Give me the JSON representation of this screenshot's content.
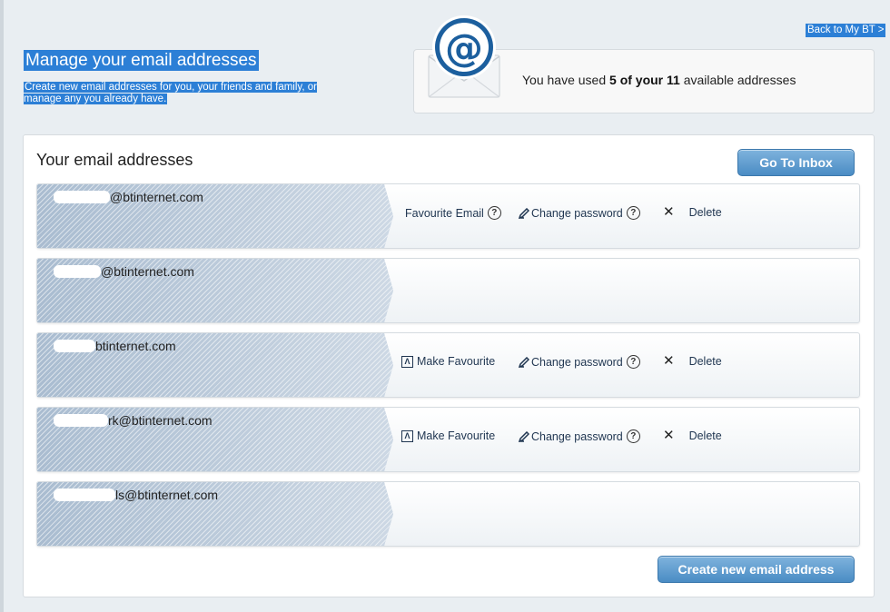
{
  "header": {
    "back_link": "Back to My BT >",
    "title": "Manage your email addresses",
    "subtitle": "Create new email addresses for you, your friends and family, or manage any you already have."
  },
  "usage": {
    "prefix": "You have used ",
    "count": "5 of your 11",
    "suffix": " available addresses"
  },
  "panel": {
    "title": "Your email addresses",
    "inbox_button": "Go To Inbox",
    "create_button": "Create new email address"
  },
  "actions": {
    "favourite_email": "Favourite Email",
    "make_favourite": "Make Favourite",
    "change_password": "Change password",
    "delete": "Delete"
  },
  "emails": [
    {
      "address": "@btinternet.com"
    },
    {
      "address": "@btinternet.com"
    },
    {
      "address": "btinternet.com"
    },
    {
      "address": "rk@btinternet.com"
    },
    {
      "address": "ls@btinternet.com"
    }
  ],
  "colors": {
    "accent": "#2c7fd6",
    "button": "#4a8cc4",
    "background": "#e9eef2"
  }
}
